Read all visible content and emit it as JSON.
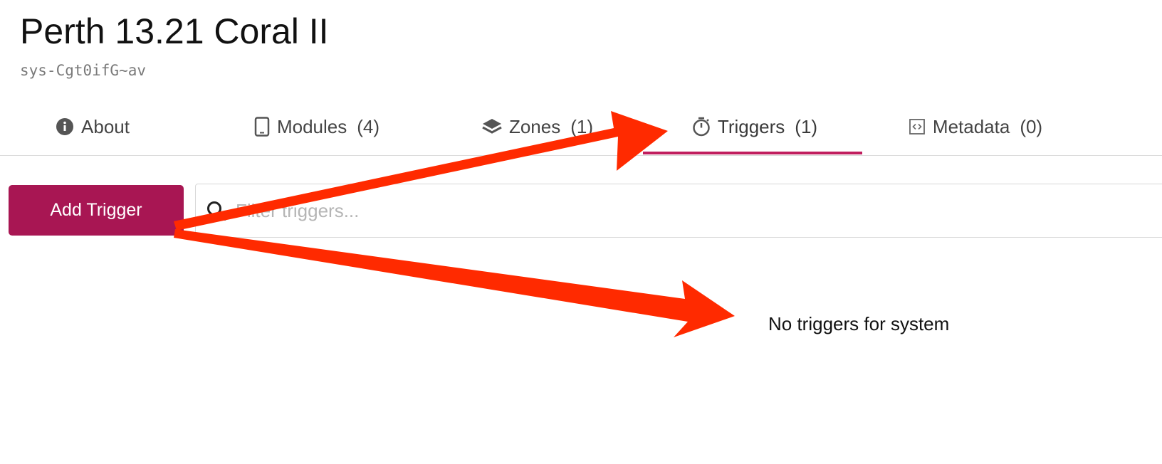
{
  "header": {
    "title": "Perth 13.21 Coral II",
    "system_id": "sys-Cgt0ifG~av"
  },
  "tabs": [
    {
      "label": "About",
      "count": "",
      "icon": "info-circle-icon"
    },
    {
      "label": "Modules",
      "count": "(4)",
      "icon": "tablet-icon"
    },
    {
      "label": "Zones",
      "count": "(1)",
      "icon": "layers-icon"
    },
    {
      "label": "Triggers",
      "count": "(1)",
      "icon": "stopwatch-icon",
      "active": true
    },
    {
      "label": "Metadata",
      "count": "(0)",
      "icon": "code-box-icon"
    }
  ],
  "toolbar": {
    "add_label": "Add Trigger",
    "filter_placeholder": "Filter triggers..."
  },
  "empty_state": {
    "message": "No triggers for system"
  },
  "colors": {
    "accent": "#c01e5e",
    "button": "#a81653",
    "annotation_arrow": "#ff2a00"
  }
}
